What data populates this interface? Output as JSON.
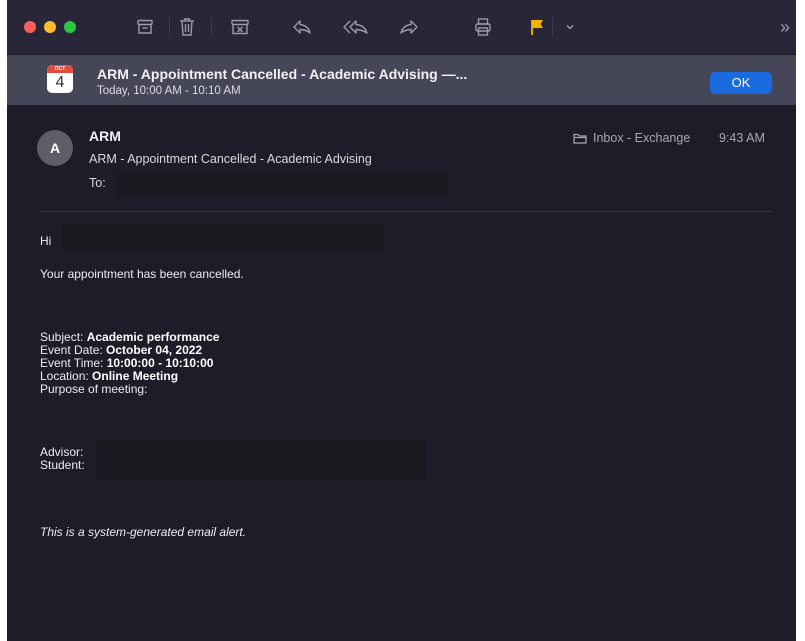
{
  "toolbar": {
    "traffic_colors": [
      "#ff5f57",
      "#febc2e",
      "#28c840"
    ],
    "icons": [
      "archive-icon",
      "trash-icon",
      "junk-icon",
      "reply-icon",
      "reply-all-icon",
      "forward-icon",
      "print-icon",
      "flag-icon",
      "chevron-down-icon",
      "more-icon"
    ],
    "flag_color": "#f5b400",
    "more_label": "»"
  },
  "banner": {
    "calendar_month": "OCT",
    "calendar_day": "4",
    "title": "ARM - Appointment Cancelled - Academic Advising —...",
    "time": "Today, 10:00 AM - 10:10 AM",
    "ok_label": "OK",
    "ok_color": "#1a6ae0"
  },
  "message": {
    "avatar_initial": "A",
    "sender": "ARM",
    "subject": "ARM - Appointment Cancelled - Academic Advising",
    "to_label": "To:",
    "mailbox": "Inbox - Exchange",
    "received_time": "9:43 AM"
  },
  "body": {
    "greeting": "Hi",
    "intro": "Your appointment has been cancelled.",
    "details": [
      {
        "label": "Subject: ",
        "value": "Academic performance"
      },
      {
        "label": "Event Date: ",
        "value": "October 04, 2022"
      },
      {
        "label": "Event Time: ",
        "value": "10:00:00 - 10:10:00"
      },
      {
        "label": "Location: ",
        "value": "Online Meeting"
      },
      {
        "label": "Purpose of meeting:",
        "value": ""
      }
    ],
    "advisor_label": "Advisor:",
    "student_label": "Student:",
    "footer": "This is a system-generated email alert."
  }
}
